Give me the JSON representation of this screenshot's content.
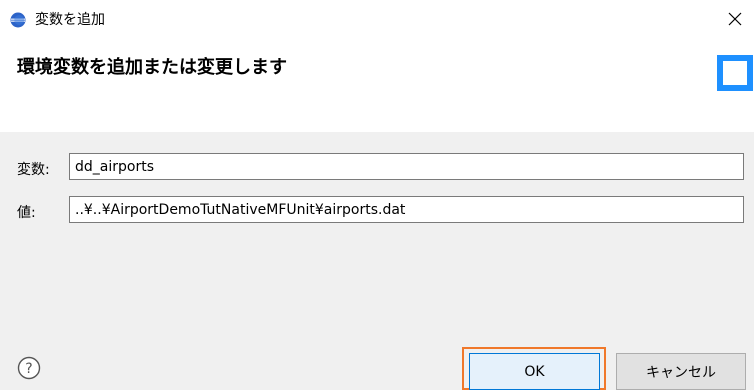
{
  "window": {
    "title": "変数を追加",
    "close_glyph": "×",
    "icon": "eclipse-app-icon"
  },
  "header": {
    "title": "環境変数を追加または変更します"
  },
  "form": {
    "variable_label": "変数:",
    "variable_value": "dd_airports",
    "value_label": "値:",
    "value_value": "..¥..¥AirportDemoTutNativeMFUnit¥airports.dat"
  },
  "buttons": {
    "help_glyph": "?",
    "ok_label": "OK",
    "cancel_label": "キャンセル"
  },
  "colors": {
    "accent": "#0078d7",
    "focus_outline": "#f0782a",
    "body_background": "#f0f0f0"
  }
}
